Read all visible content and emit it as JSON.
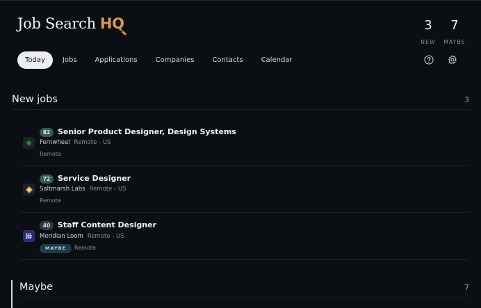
{
  "app": {
    "title_main": "Job Search",
    "title_accent": "HQ"
  },
  "stats": {
    "new": {
      "value": "3",
      "label": "NEW"
    },
    "maybe": {
      "value": "7",
      "label": "MAYBE"
    }
  },
  "nav": {
    "tabs": [
      {
        "label": "Today",
        "active": true
      },
      {
        "label": "Jobs"
      },
      {
        "label": "Applications"
      },
      {
        "label": "Companies"
      },
      {
        "label": "Contacts"
      },
      {
        "label": "Calendar"
      }
    ],
    "icons": [
      "help-icon",
      "settings-icon"
    ]
  },
  "sections": {
    "new_jobs": {
      "title": "New jobs",
      "count": "3",
      "items": [
        {
          "score": "82",
          "score_color": "#2f5e4a",
          "title": "Senior Product Designer, Design Systems",
          "company": "Fernwheel",
          "location": "Remote - US",
          "workmode": "Remote",
          "icon": "fernwheel-logo-icon"
        },
        {
          "score": "72",
          "score_color": "#2f5e4a",
          "title": "Service Designer",
          "company": "Saltmarsh Labs",
          "location": "Remote - US",
          "workmode": "Remote",
          "icon": "saltmarsh-logo-icon"
        },
        {
          "score": "40",
          "score_color": "#343a42",
          "title": "Staff Content Designer",
          "company": "Meridian Loom",
          "location": "Remote - US",
          "badge": "MAYBE",
          "workmode": "Remote",
          "icon": "meridian-logo-icon"
        }
      ]
    },
    "maybe": {
      "title": "Maybe",
      "count": "7"
    }
  },
  "colors": {
    "background": "#0b0e13",
    "accent": "#d99a4a",
    "score_high": "#2f5e4a",
    "score_low": "#343a42",
    "badge_maybe": "#1f3a48"
  }
}
